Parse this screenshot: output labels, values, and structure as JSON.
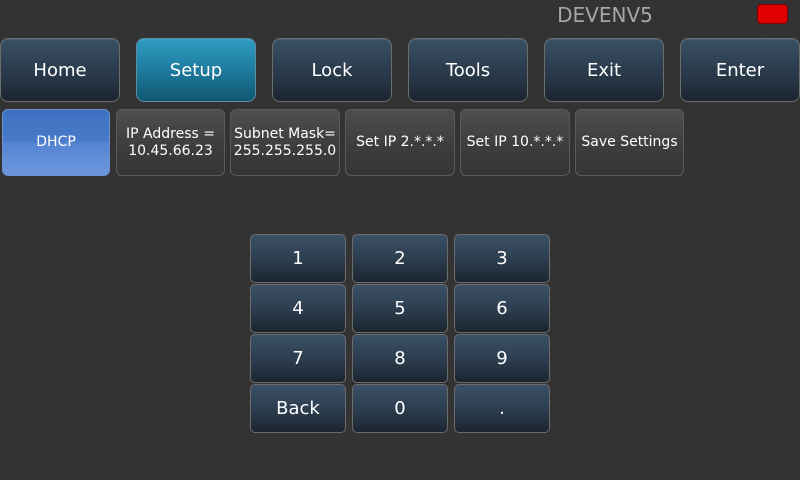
{
  "header": {
    "title": "DEVENV5",
    "status_color": "#e00000"
  },
  "nav": {
    "home": "Home",
    "setup": "Setup",
    "lock": "Lock",
    "tools": "Tools",
    "exit": "Exit",
    "enter": "Enter",
    "active": "Setup"
  },
  "config": {
    "dhcp": "DHCP",
    "ip_address_label": "IP Address =",
    "ip_address_value": "10.45.66.23",
    "subnet_mask_label": "Subnet Mask=",
    "subnet_mask_value": "255.255.255.0",
    "set_ip_2": "Set IP 2.*.*.*",
    "set_ip_10": "Set IP 10.*.*.*",
    "save_settings": "Save Settings"
  },
  "keypad": {
    "k1": "1",
    "k2": "2",
    "k3": "3",
    "k4": "4",
    "k5": "5",
    "k6": "6",
    "k7": "7",
    "k8": "8",
    "k9": "9",
    "back": "Back",
    "k0": "0",
    "dot": "."
  }
}
